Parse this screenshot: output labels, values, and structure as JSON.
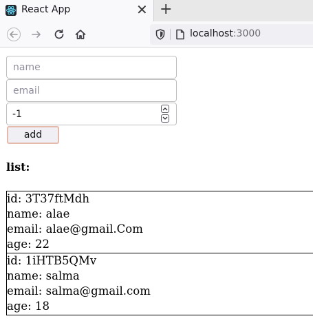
{
  "browser": {
    "tab_title": "React App",
    "url_host": "localhost",
    "url_port": ":3000"
  },
  "form": {
    "name_placeholder": "name",
    "email_placeholder": "email",
    "age_value": "-1",
    "add_label": "add"
  },
  "list": {
    "heading": "list:",
    "items": [
      {
        "id": "id: 3T37ftMdh",
        "name": "name: alae",
        "email": "email: alae@gmail.Com",
        "age": "age: 22"
      },
      {
        "id": "id: 1iHTB5QMv",
        "name": "name: salma",
        "email": "email: salma@gmail.com",
        "age": "age: 18"
      }
    ]
  },
  "icons": [
    "react-icon",
    "close-icon",
    "plus-icon",
    "back-arrow-icon",
    "forward-arrow-icon",
    "reload-icon",
    "home-icon",
    "shield-icon",
    "page-icon",
    "chevron-up-icon",
    "chevron-down-icon"
  ]
}
